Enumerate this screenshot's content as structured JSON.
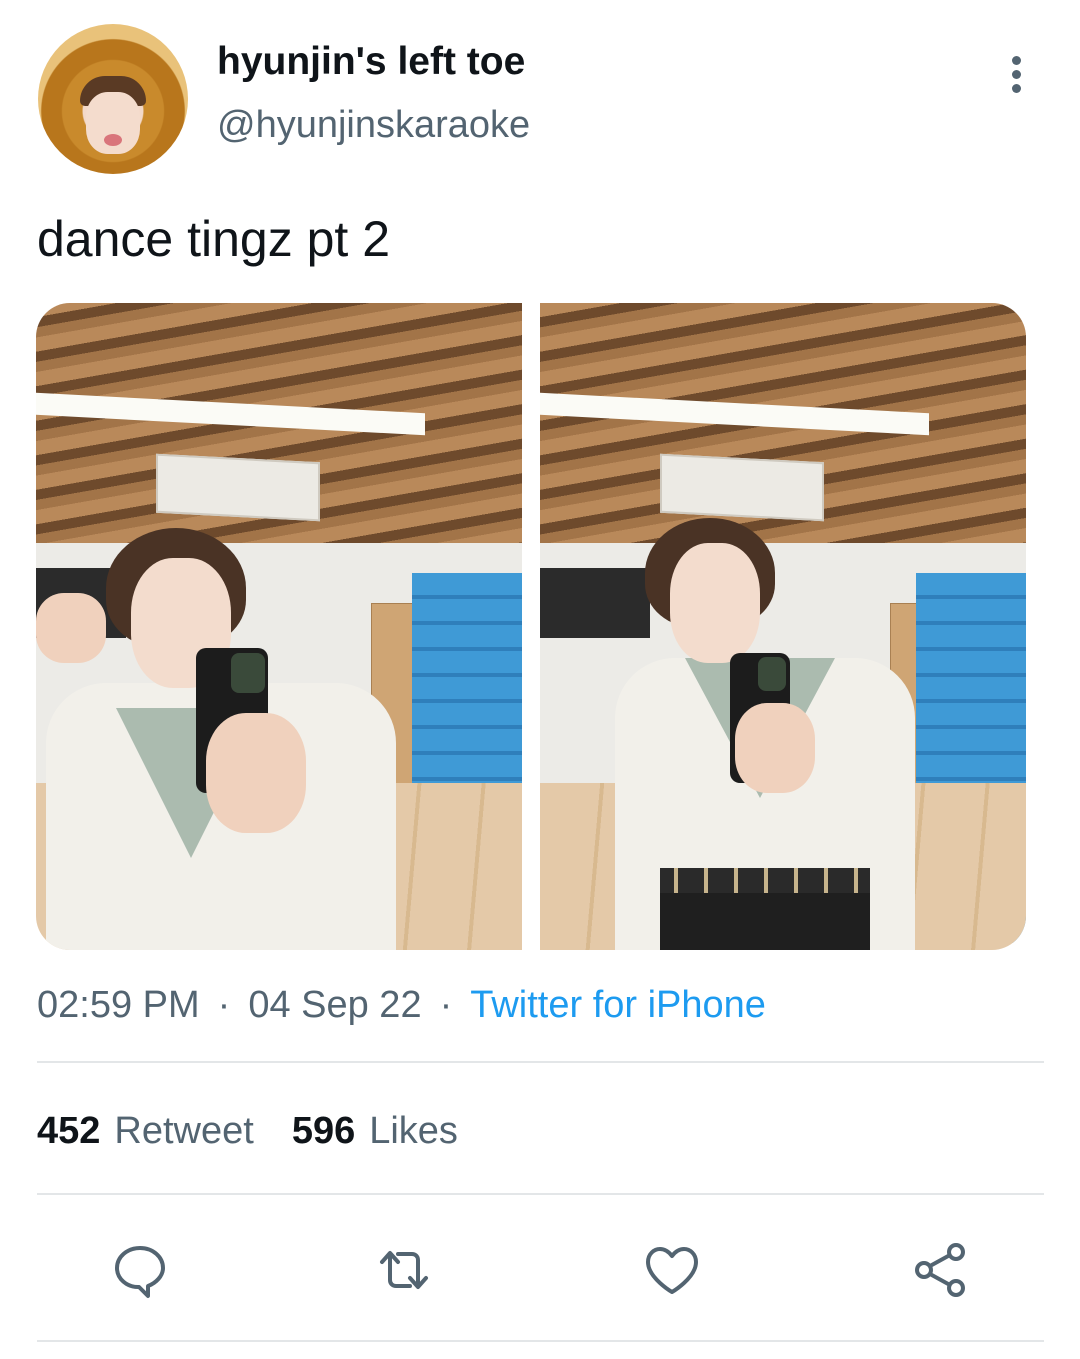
{
  "author": {
    "display_name": "hyunjin's left toe",
    "handle": "@hyunjinskaraoke"
  },
  "tweet": {
    "text": "dance tingz pt 2",
    "time": "02:59 PM",
    "date": "04 Sep 22",
    "source": "Twitter for iPhone",
    "separator": "·"
  },
  "stats": {
    "retweets_count": "452",
    "retweets_label": "Retweet",
    "likes_count": "596",
    "likes_label": "Likes"
  },
  "icons": {
    "more": "more-vertical-icon",
    "reply": "reply-icon",
    "retweet": "retweet-icon",
    "like": "heart-icon",
    "share": "share-icon"
  },
  "colors": {
    "accent": "#1d9bf0",
    "secondary_text": "#536471",
    "primary_text": "#0f1419",
    "divider": "#e3e6e8"
  }
}
